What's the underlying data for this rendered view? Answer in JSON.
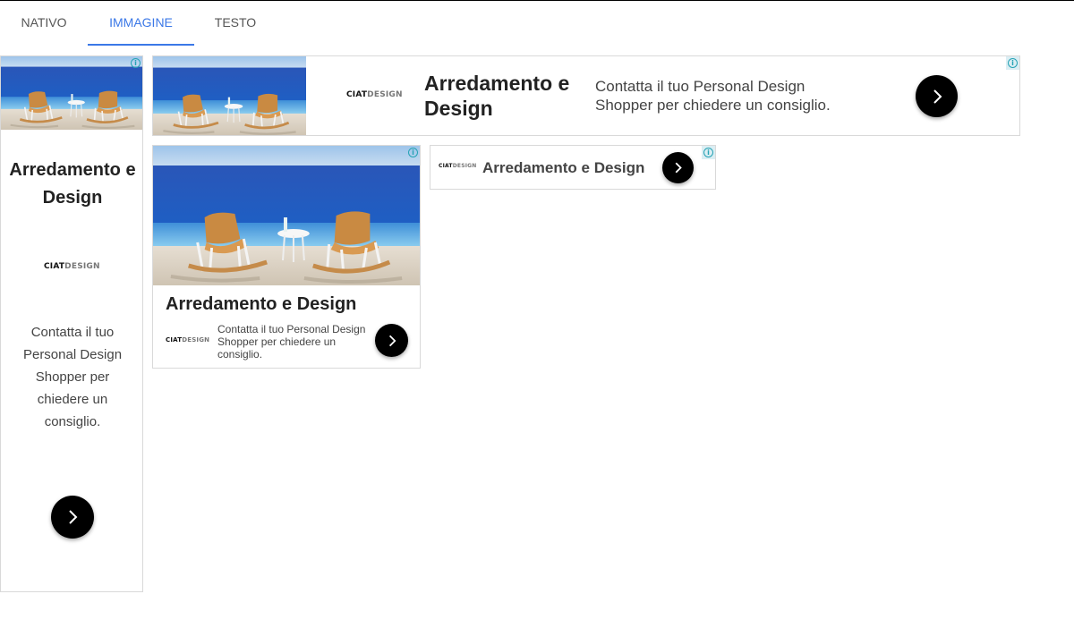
{
  "tabs": [
    {
      "label": "NATIVO"
    },
    {
      "label": "IMMAGINE"
    },
    {
      "label": "TESTO"
    }
  ],
  "ad": {
    "headline": "Arredamento e Design",
    "description": "Contatta il tuo Personal Design Shopper per chiedere un consiglio.",
    "logo_primary": "CIAT",
    "logo_secondary": "DESIGN",
    "adchoices_icon": "info-icon",
    "cta_icon": "chevron-right-icon"
  },
  "colors": {
    "active_tab": "#3b78e7",
    "cta_background": "#000000",
    "adchoices": "#26a3b5"
  }
}
